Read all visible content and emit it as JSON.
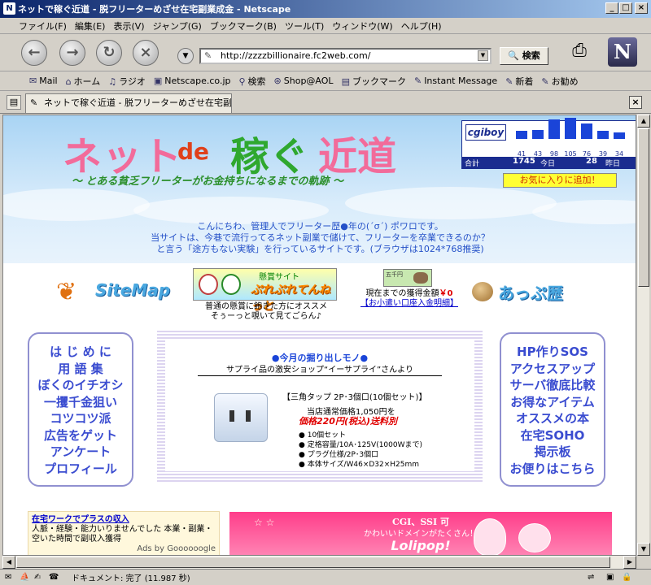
{
  "window": {
    "title": "ネットで稼ぐ近道 - 脱フリーターめざせ在宅副業成金 - Netscape"
  },
  "menu": [
    "ファイル(F)",
    "編集(E)",
    "表示(V)",
    "ジャンプ(G)",
    "ブックマーク(B)",
    "ツール(T)",
    "ウィンドウ(W)",
    "ヘルプ(H)"
  ],
  "nav": {
    "url": "http://zzzzbillionaire.fc2web.com/",
    "search_label": "検索"
  },
  "personal_toolbar": [
    "Mail",
    "ホーム",
    "ラジオ",
    "Netscape.co.jp",
    "検索",
    "Shop@AOL",
    "ブックマーク",
    "Instant Message",
    "新着",
    "お勧め"
  ],
  "tab": {
    "label": "ネットで稼ぐ近道 - 脱フリーターめざせ在宅副..."
  },
  "page": {
    "logo": {
      "part1": "ネット",
      "part2": "de",
      "part3": "稼ぐ",
      "part4": "近道"
    },
    "tagline": "～ とある貧乏フリーターがお金持ちになるまでの軌跡 ～",
    "counter": {
      "brand": "cgiboy",
      "values": [
        "41",
        "43",
        "98",
        "105",
        "76",
        "39",
        "34"
      ],
      "total_label": "合計",
      "total": "1745",
      "today_label": "今日",
      "today": "28",
      "yesterday_label": "昨日"
    },
    "fav_button": "お気に入りに追加！",
    "welcome": [
      "こんにちわ、管理人でフリーター歴●年の(´σ´) ポワロです。",
      "当サイトは、今巷で流行ってるネット副業で儲けて、フリーターを卒業できるのか？",
      "と言う「途方もない実験」を行っているサイトです。(ブラウザは1024*768推奨)"
    ],
    "sitemap": "SiteMap",
    "appu": "あっぷ歴",
    "banner": {
      "top": "懸賞サイト",
      "main": "ぷれぷれてんねっと",
      "caption1": "普通の懸賞に飽きた方にオススメ",
      "caption2": "そぅーっと覗いて見てごらん♪"
    },
    "earnings": {
      "note": "五千円",
      "label": "現在までの獲得金額",
      "amount": "￥0",
      "link": "【お小遣い口座入金明細】"
    },
    "left_menu": [
      "は じ め に",
      "用 語 集",
      "ぼくのイチオシ",
      "一攫千金狙い",
      "コツコツ派",
      "広告をゲット",
      "アンケート",
      "プロフィール"
    ],
    "right_menu": [
      "HP作りSOS",
      "アクセスアップ",
      "サーバ徹底比較",
      "お得なアイテム",
      "オススメの本",
      "在宅SOHO",
      "掲示板",
      "お便りはこちら"
    ],
    "pickup": {
      "title": "●今月の掘り出しモノ●",
      "subtitle": "サプライ品の激安ショップ“イーサプライ”さんより",
      "product": "【三角タップ 2P･3個口(10個セット)】",
      "price_label": "当店通常価格1,050円を",
      "sale": "価格220円(税込)送料別",
      "specs": [
        "● 10個セット",
        "● 定格容量/10A･125V(1000Wまで)",
        "● プラグ仕様/2P･3個口",
        "● 本体サイズ/W46×D32×H25mm"
      ]
    },
    "ad": {
      "title": "在宅ワークでプラスの収入",
      "body": "人脈・経験・能力いりませんでした 本業・副業・空いた時間で副収入獲得",
      "footer": "Ads by Goooooogle"
    },
    "lolipop": {
      "line1": "CGI、SSI 可",
      "line2": "かわいいドメインがたくさん！",
      "brand": "Lolipop!"
    }
  },
  "status": {
    "text": "ドキュメント: 完了 (11.987 秒)"
  }
}
